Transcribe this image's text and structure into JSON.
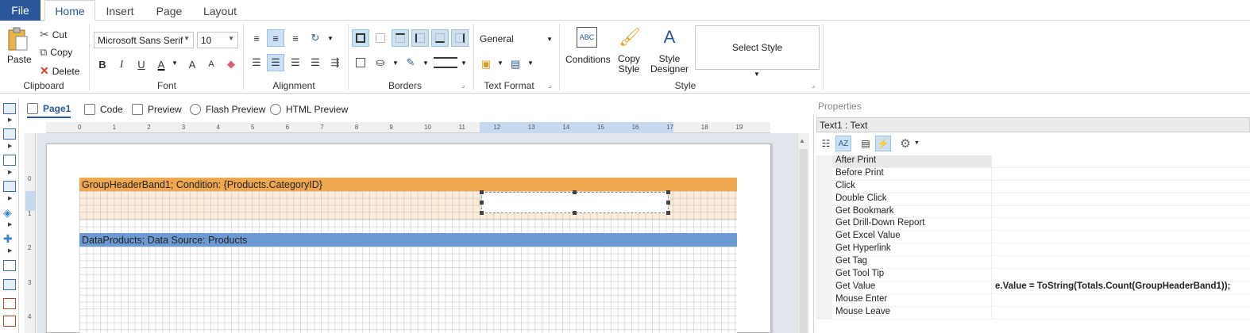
{
  "menu_tabs": [
    "File",
    "Home",
    "Insert",
    "Page",
    "Layout"
  ],
  "clipboard": {
    "paste": "Paste",
    "cut": "Cut",
    "copy": "Copy",
    "delete": "Delete",
    "group_label": "Clipboard"
  },
  "font": {
    "family": "Microsoft Sans Serif",
    "size": "10",
    "bold": "B",
    "italic": "I",
    "underline": "U",
    "font_color": "A",
    "grow": "A",
    "shrink": "A",
    "group_label": "Font"
  },
  "alignment": {
    "group_label": "Alignment"
  },
  "borders": {
    "group_label": "Borders"
  },
  "text_format": {
    "value": "General",
    "group_label": "Text Format"
  },
  "style": {
    "conditions": "Conditions",
    "copy_style_1": "Copy",
    "copy_style_2": "Style",
    "style_designer_1": "Style",
    "style_designer_2": "Designer",
    "select_style": "Select Style",
    "group_label": "Style"
  },
  "view_tabs": {
    "page1": "Page1",
    "code": "Code",
    "preview": "Preview",
    "flash_preview": "Flash Preview",
    "html_preview": "HTML Preview"
  },
  "ruler_top": [
    "0",
    "1",
    "2",
    "3",
    "4",
    "5",
    "6",
    "7",
    "8",
    "9",
    "10",
    "11",
    "12",
    "13",
    "14",
    "15",
    "16",
    "17",
    "18",
    "19"
  ],
  "ruler_left": [
    "0",
    "1",
    "2",
    "3",
    "4"
  ],
  "bands": {
    "group_header": "GroupHeaderBand1; Condition: {Products.CategoryID}",
    "data": "DataProducts; Data Source: Products"
  },
  "properties": {
    "header": "Properties",
    "object": "Text1 : Text",
    "events": [
      {
        "name": "After Print",
        "value": ""
      },
      {
        "name": "Before Print",
        "value": ""
      },
      {
        "name": "Click",
        "value": ""
      },
      {
        "name": "Double Click",
        "value": ""
      },
      {
        "name": "Get Bookmark",
        "value": ""
      },
      {
        "name": "Get Drill-Down Report",
        "value": ""
      },
      {
        "name": "Get Excel Value",
        "value": ""
      },
      {
        "name": "Get Hyperlink",
        "value": ""
      },
      {
        "name": "Get Tag",
        "value": ""
      },
      {
        "name": "Get Tool Tip",
        "value": ""
      },
      {
        "name": "Get Value",
        "value": "e.Value = ToString(Totals.Count(GroupHeaderBand1));"
      },
      {
        "name": "Mouse Enter",
        "value": ""
      },
      {
        "name": "Mouse Leave",
        "value": ""
      }
    ]
  },
  "colors": {
    "accent": "#2b579a",
    "group_header_band": "#f0a850",
    "data_band": "#6d9ad2"
  }
}
